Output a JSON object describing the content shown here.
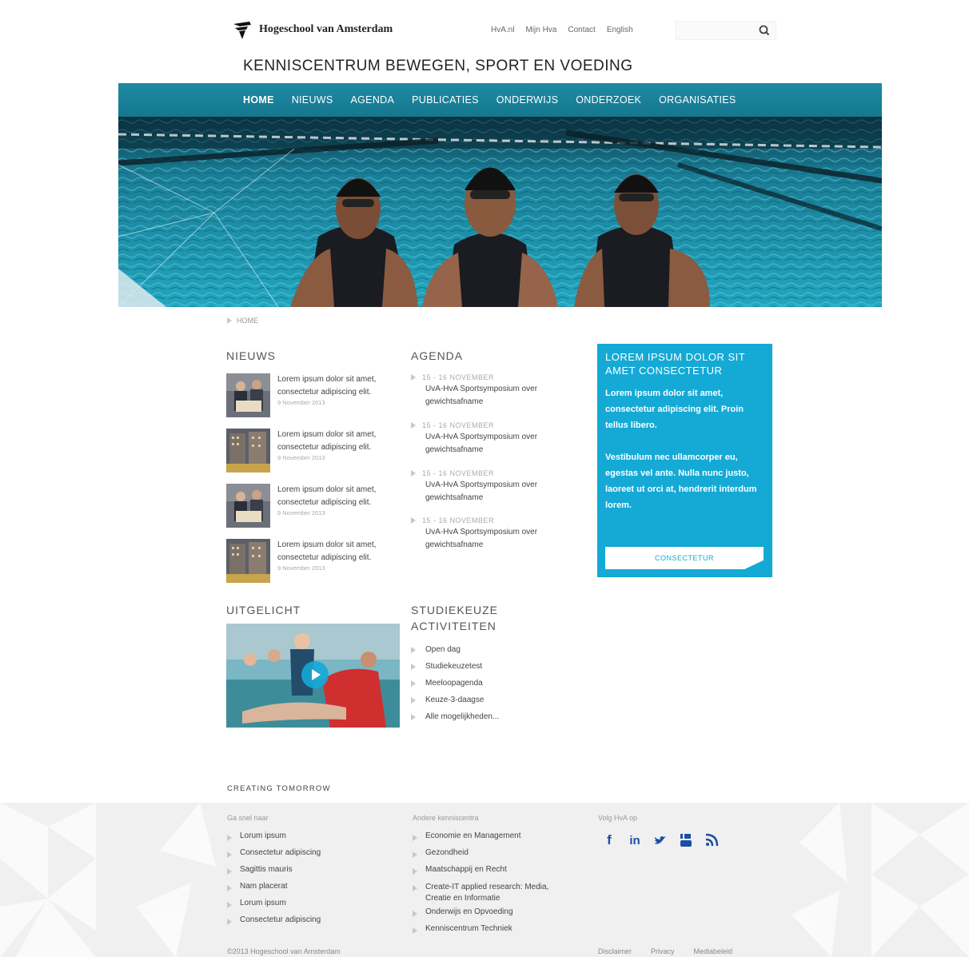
{
  "header": {
    "logo_text": "Hogeschool van Amsterdam",
    "top_links": [
      "HvA.nl",
      "Mijn Hva",
      "Contact",
      "English"
    ],
    "search": {
      "placeholder": "",
      "value": ""
    },
    "site_title": "KENNISCENTRUM BEWEGEN, SPORT EN VOEDING"
  },
  "nav": {
    "items": [
      "HOME",
      "NIEUWS",
      "AGENDA",
      "PUBLICATIES",
      "ONDERWIJS",
      "ONDERZOEK",
      "ORGANISATIES"
    ],
    "active": "HOME"
  },
  "breadcrumb": {
    "home": "HOME"
  },
  "news": {
    "title": "NIEUWS",
    "items": [
      {
        "text": "Lorem ipsum dolor sit amet, consectetur adipiscing elit.",
        "date": "9 November 2013"
      },
      {
        "text": "Lorem ipsum dolor sit amet, consectetur adipiscing elit.",
        "date": "9 November 2013"
      },
      {
        "text": "Lorem ipsum dolor sit amet, consectetur adipiscing elit.",
        "date": "9 November 2013"
      },
      {
        "text": "Lorem ipsum dolor sit amet, consectetur adipiscing elit.",
        "date": "9 November 2013"
      }
    ]
  },
  "agenda": {
    "title": "AGENDA",
    "items": [
      {
        "date": "15 - 16 NOVEMBER",
        "text": "UvA-HvA Sportsymposium over gewichtsafname"
      },
      {
        "date": "15 - 16 NOVEMBER",
        "text": "UvA-HvA Sportsymposium over gewichtsafname"
      },
      {
        "date": "15 - 16 NOVEMBER",
        "text": "UvA-HvA Sportsymposium over gewichtsafname"
      },
      {
        "date": "15 - 16 NOVEMBER",
        "text": "UvA-HvA Sportsymposium over gewichtsafname"
      }
    ]
  },
  "promo": {
    "title": "LOREM IPSUM DOLOR SIT AMET CONSECTETUR",
    "paragraph1": "Lorem ipsum dolor sit amet, consectetur adipiscing elit. Proin tellus libero.",
    "paragraph2": "Vestibulum nec ullamcorper eu, egestas vel ante. Nulla nunc justo, laoreet ut orci at, hendrerit interdum lorem.",
    "button": "CONSECTETUR",
    "color": "#15a9d6"
  },
  "featured": {
    "title": "UITGELICHT"
  },
  "studiekeuze": {
    "title_line1": "STUDIEKEUZE",
    "title_line2": "ACTIVITEITEN",
    "items": [
      "Open dag",
      "Studiekeuzetest",
      "Meeloopagenda",
      "Keuze-3-daagse",
      "Alle mogelijkheden..."
    ]
  },
  "footer": {
    "tagline": "CREATING TOMORROW",
    "col1_title": "Ga snel naar",
    "col1_items": [
      "Lorum ipsum",
      "Consectetur adipiscing",
      "Sagittis mauris",
      "Nam placerat",
      "Lorum ipsum",
      "Consectetur adipiscing"
    ],
    "col2_title": "Andere kenniscentra",
    "col2_items": [
      "Economie en Management",
      "Gezondheid",
      "Maatschappij en Recht",
      "Create-IT applied research: Media, Creatie en Informatie",
      "Onderwijs en Opvoeding",
      "Kenniscentrum Techniek"
    ],
    "col3_title": "Volg HvA op",
    "social_icons": [
      "facebook-icon",
      "linkedin-icon",
      "twitter-icon",
      "youtube-icon",
      "rss-icon"
    ],
    "copyright": "©2013 Hogeschool van Amsterdam",
    "legal_links": [
      "Disclaimer",
      "Privacy",
      "Mediabeleid"
    ]
  }
}
